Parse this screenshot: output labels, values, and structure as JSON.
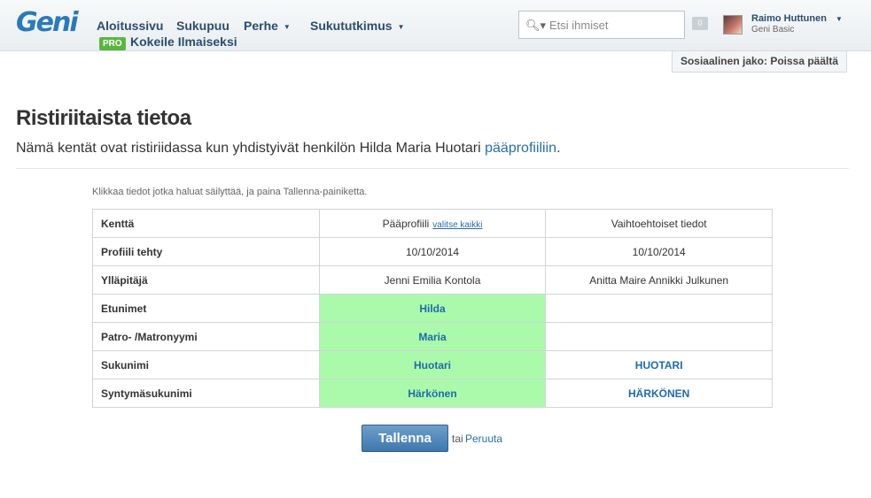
{
  "header": {
    "logo": "Geni",
    "nav": [
      {
        "label": "Aloitussivu",
        "dropdown": false
      },
      {
        "label": "Sukupuu",
        "dropdown": false
      },
      {
        "label": "Perhe",
        "dropdown": true
      },
      {
        "label": "Sukututkimus",
        "dropdown": true
      }
    ],
    "pro_badge": "PRO",
    "pro_text": "Kokeile Ilmaiseksi",
    "search_placeholder": "Etsi ihmiset",
    "notification_count": "0",
    "user_name": "Raimo Huttunen",
    "user_plan": "Geni Basic",
    "social_sharing": "Sosiaalinen jako: Poissa päältä"
  },
  "page": {
    "title": "Ristiriitaista tietoa",
    "subtitle_text": "Nämä kentät ovat ristiriidassa kun yhdistyivät henkilön Hilda Maria Huotari ",
    "subtitle_link": "pääprofiiliin",
    "subtitle_end": ".",
    "instructions": "Klikkaa tiedot jotka haluat säilyttää, ja paina Tallenna-painiketta."
  },
  "table": {
    "headers": {
      "field": "Kenttä",
      "main": "Pääprofiili",
      "select_all": "valitse kaikki",
      "alt": "Vaihtoehtoiset tiedot"
    },
    "rows": [
      {
        "field": "Profiili tehty",
        "main": "10/10/2014",
        "alt": "10/10/2014"
      },
      {
        "field": "Ylläpitäjä",
        "main": "Jenni Emilia Kontola",
        "alt": "Anitta Maire Annikki Julkunen"
      },
      {
        "field": "Etunimet",
        "main": "Hilda",
        "alt": ""
      },
      {
        "field": "Patro- /Matronyymi",
        "main": "Maria",
        "alt": ""
      },
      {
        "field": "Sukunimi",
        "main": "Huotari",
        "alt": "HUOTARI"
      },
      {
        "field": "Syntymäsukunimi",
        "main": "Härkönen",
        "alt": "HÄRKÖNEN"
      }
    ],
    "selected_color": "#abfaab"
  },
  "actions": {
    "save": "Tallenna",
    "or": "tai",
    "cancel": "Peruuta"
  }
}
